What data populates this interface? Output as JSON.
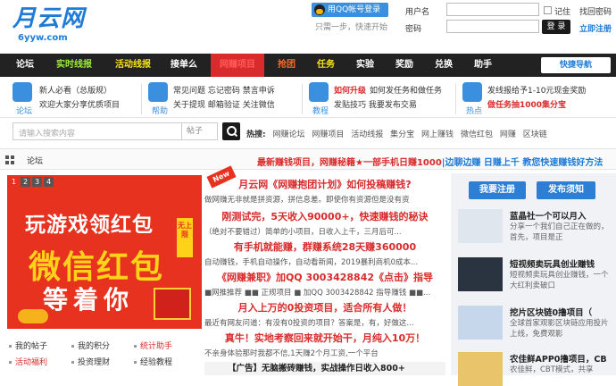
{
  "logo": {
    "text": "月云网",
    "domain": "6yyw.com"
  },
  "login": {
    "qq_button": "用QQ帐号登录",
    "qq_hint": "只需一步，快速开始",
    "username_label": "用户名",
    "password_label": "密码",
    "remember_label": "记住",
    "forgot": "找回密码",
    "login_button": "登 录",
    "register": "立即注册"
  },
  "nav": {
    "items": [
      "论坛",
      "实时线报",
      "活动线报",
      "接单么",
      "网赚项目",
      "抢团",
      "任务",
      "实验",
      "奖励",
      "兑换",
      "助手"
    ],
    "quick_nav": "快捷导航"
  },
  "info": {
    "block1": {
      "caption": "论坛",
      "lines": [
        "新人必看（总版规）",
        "欢迎大家分享优质项目"
      ]
    },
    "block2": {
      "caption": "帮助",
      "lines": [
        "常见问题 忘记密码 禁言申诉",
        "关于提现 邮箱验证 关注微信"
      ]
    },
    "block3": {
      "caption": "教程",
      "l1a": "如何升级",
      "l1b": "如何发任务和做任务",
      "l2": "发贴技巧 我要发布交易"
    },
    "block4": {
      "caption": "热点",
      "l1": "发线报给予1-10元现金奖励",
      "l2": "做任务抽1000集分宝"
    }
  },
  "search": {
    "placeholder": "请输入搜索内容",
    "scope": "帖子",
    "hot_label": "热搜:",
    "hot": [
      "网赚论坛",
      "网赚项目",
      "活动线报",
      "集分宝",
      "网上赚钱",
      "微信红包",
      "网赚",
      "区块链"
    ]
  },
  "crumb": {
    "title": "论坛",
    "notice_red": "最新赚钱项目，网赚秘籍★一部手机日赚1000",
    "notice_blue": "|边聊边赚 日赚上千 教您快速赚钱好方法"
  },
  "banner": {
    "nums": [
      "1",
      "2",
      "3",
      "4"
    ],
    "line1": "玩游戏领红包",
    "line2": "微信红包",
    "line3": "等着你",
    "tag": "无上限"
  },
  "links": [
    [
      "我的帖子",
      "我的积分",
      "统计助手"
    ],
    [
      "活动福利",
      "投资理财",
      "经验教程"
    ]
  ],
  "new_tag": "New",
  "articles": [
    {
      "title": "月云网《网赚抱团计划》如何投稿赚钱?",
      "desc": "做网赚无非就是拼资源，拼信息差。即使你有资源但是没有资"
    },
    {
      "title": "刚测试完，5天收入90000+，快速赚钱的秘诀",
      "desc": "（绝对不要错过）简单的小项目，日收入上千，三月后可..."
    },
    {
      "title": "有手机就能赚，群赚系统28天赚360000",
      "desc": "自动赚钱，手机自动操作，自动看新闻，2019暴利商机0成本..."
    },
    {
      "title": "《网赚兼职》加QQ 3003428842《点击》指导",
      "desc": "■网推推荐 ■■ 正规项目 ■ 加QQ 3003428842 指导赚钱 ■■..."
    },
    {
      "title": "月入上万的0投资项目，适合所有人做！",
      "desc": "最近有网友问道：有没有0投资的项目？答案是，有，好做这..."
    },
    {
      "title": "真牛！实地考察回来就开始干，月纯入10万！",
      "desc": "不亲身体验那时我都不信,1天赚2个月工资,一个平台"
    }
  ],
  "ad": "【广告】无脑搬砖赚钱，实战操作日收入800+",
  "right": {
    "register": "我要注册",
    "publish": "发布须知",
    "posts": [
      {
        "title": "蓝晶社一个可以月入",
        "desc": "分享一个我们自己正在做的，首先，项目是正"
      },
      {
        "title": "短视频卖玩具创业赚钱",
        "desc": "短视频卖玩具创业赚钱，一个大红利卖破口"
      },
      {
        "title": "挖片区块链0撸项目（",
        "desc": "全球首家观影区块链应用投片上线，免费观影"
      },
      {
        "title": "农佳鲜APP0撸项目，CB",
        "desc": "农佳鲜，CBT模式，共享"
      }
    ]
  }
}
